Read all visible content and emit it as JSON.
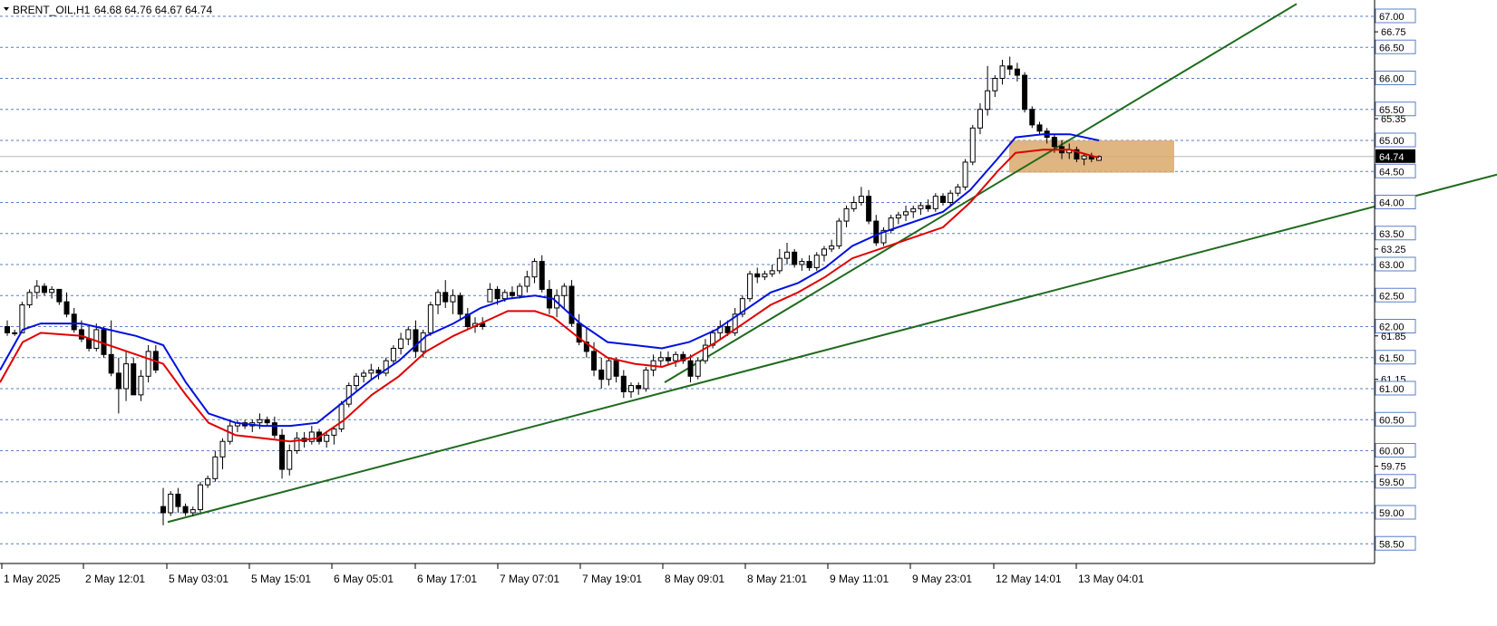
{
  "header": {
    "symbol": "BRENT_OIL,H1",
    "ohlc": "64.68 64.76 64.67 64.74"
  },
  "colors": {
    "background": "#ffffff",
    "grid": "#5b7fc7",
    "bull_candle": "#ffffff",
    "bear_candle": "#000000",
    "candle_outline": "#000000",
    "ma_fast": "#e00000",
    "ma_slow": "#0010e0",
    "trendline": "#1e6a1e",
    "zone_fill": "#d9a86b",
    "price_tag_bg": "#000000",
    "level_tag_bg": "#ffffff"
  },
  "chart_data": {
    "type": "candlestick",
    "timeframe": "H1",
    "y_range": [
      58.3,
      67.0
    ],
    "price_levels": [
      67.0,
      66.5,
      66.0,
      65.5,
      65.0,
      64.5,
      64.0,
      63.5,
      63.0,
      62.5,
      62.0,
      61.5,
      61.0,
      60.5,
      60.0,
      59.5,
      59.0,
      58.5
    ],
    "axis_ticks": [
      "67.00",
      "66.75",
      "66.50",
      "66.00",
      "65.50",
      "65.35",
      "65.00",
      "64.74",
      "64.50",
      "64.00",
      "63.50",
      "63.25",
      "63.00",
      "62.50",
      "62.00",
      "61.85",
      "61.50",
      "61.15",
      "61.00",
      "60.50",
      "60.00",
      "59.75",
      "59.50",
      "59.00",
      "58.50"
    ],
    "current_price": "64.74",
    "x_labels": [
      "1 May 2025",
      "2 May 12:01",
      "5 May 03:01",
      "5 May 15:01",
      "6 May 05:01",
      "6 May 17:01",
      "7 May 07:01",
      "7 May 19:01",
      "8 May 09:01",
      "8 May 21:01",
      "9 May 11:01",
      "9 May 23:01",
      "12 May 14:01",
      "13 May 04:01"
    ],
    "candles": [
      [
        62.0,
        62.1,
        61.85,
        61.9
      ],
      [
        61.9,
        61.95,
        61.85,
        61.9
      ],
      [
        61.9,
        62.4,
        61.9,
        62.35
      ],
      [
        62.35,
        62.6,
        62.3,
        62.55
      ],
      [
        62.55,
        62.75,
        62.45,
        62.65
      ],
      [
        62.65,
        62.7,
        62.5,
        62.55
      ],
      [
        62.55,
        62.65,
        62.45,
        62.6
      ],
      [
        62.6,
        62.6,
        62.35,
        62.4
      ],
      [
        62.4,
        62.55,
        62.15,
        62.2
      ],
      [
        62.2,
        62.3,
        61.9,
        61.95
      ],
      [
        61.95,
        62.1,
        61.75,
        61.8
      ],
      [
        61.8,
        62.0,
        61.6,
        61.65
      ],
      [
        61.65,
        62.05,
        61.6,
        61.95
      ],
      [
        61.95,
        62.0,
        61.5,
        61.55
      ],
      [
        61.55,
        62.1,
        61.2,
        61.25
      ],
      [
        61.25,
        61.5,
        60.6,
        61.0
      ],
      [
        61.0,
        61.6,
        60.8,
        61.4
      ],
      [
        61.4,
        61.5,
        60.9,
        60.9
      ],
      [
        60.9,
        61.3,
        60.8,
        61.2
      ],
      [
        61.2,
        61.7,
        61.1,
        61.6
      ],
      [
        61.6,
        61.7,
        61.25,
        61.3
      ],
      [
        59.1,
        59.4,
        58.8,
        59.0
      ],
      [
        59.0,
        59.35,
        58.95,
        59.3
      ],
      [
        59.3,
        59.4,
        59.0,
        59.1
      ],
      [
        59.1,
        59.15,
        58.95,
        59.0
      ],
      [
        59.0,
        59.1,
        58.95,
        59.05
      ],
      [
        59.05,
        59.5,
        59.0,
        59.45
      ],
      [
        59.45,
        59.6,
        59.4,
        59.55
      ],
      [
        59.55,
        60.0,
        59.5,
        59.9
      ],
      [
        59.9,
        60.2,
        59.7,
        60.15
      ],
      [
        60.15,
        60.5,
        60.1,
        60.4
      ],
      [
        60.4,
        60.5,
        60.3,
        60.45
      ],
      [
        60.45,
        60.5,
        60.35,
        60.4
      ],
      [
        60.4,
        60.5,
        60.3,
        60.45
      ],
      [
        60.45,
        60.6,
        60.35,
        60.5
      ],
      [
        60.5,
        60.55,
        60.4,
        60.45
      ],
      [
        60.45,
        60.55,
        60.2,
        60.25
      ],
      [
        60.25,
        60.35,
        59.55,
        59.7
      ],
      [
        59.7,
        60.1,
        59.6,
        60.0
      ],
      [
        60.0,
        60.3,
        59.95,
        60.2
      ],
      [
        60.2,
        60.3,
        60.05,
        60.15
      ],
      [
        60.15,
        60.4,
        60.1,
        60.3
      ],
      [
        60.3,
        60.35,
        60.1,
        60.15
      ],
      [
        60.15,
        60.3,
        60.05,
        60.25
      ],
      [
        60.25,
        60.4,
        60.1,
        60.35
      ],
      [
        60.35,
        60.8,
        60.3,
        60.75
      ],
      [
        60.75,
        61.1,
        60.7,
        61.05
      ],
      [
        61.05,
        61.25,
        60.95,
        61.2
      ],
      [
        61.2,
        61.3,
        61.1,
        61.25
      ],
      [
        61.25,
        61.4,
        61.15,
        61.3
      ],
      [
        61.3,
        61.35,
        61.15,
        61.25
      ],
      [
        61.25,
        61.5,
        61.2,
        61.45
      ],
      [
        61.45,
        61.7,
        61.4,
        61.65
      ],
      [
        61.65,
        61.9,
        61.55,
        61.8
      ],
      [
        61.8,
        62.0,
        61.7,
        61.95
      ],
      [
        61.95,
        62.1,
        61.5,
        61.6
      ],
      [
        61.6,
        61.95,
        61.5,
        61.9
      ],
      [
        61.9,
        62.4,
        61.85,
        62.35
      ],
      [
        62.35,
        62.6,
        62.2,
        62.55
      ],
      [
        62.55,
        62.75,
        62.3,
        62.4
      ],
      [
        62.4,
        62.6,
        62.2,
        62.5
      ],
      [
        62.5,
        62.55,
        62.1,
        62.2
      ],
      [
        62.2,
        62.3,
        61.95,
        62.0
      ],
      [
        62.0,
        62.15,
        61.9,
        62.05
      ],
      [
        62.05,
        62.15,
        61.95,
        62.0
      ],
      [
        62.4,
        62.7,
        62.4,
        62.6
      ],
      [
        62.6,
        62.65,
        62.35,
        62.45
      ],
      [
        62.45,
        62.6,
        62.4,
        62.55
      ],
      [
        62.55,
        62.65,
        62.45,
        62.5
      ],
      [
        62.5,
        62.7,
        62.45,
        62.65
      ],
      [
        62.65,
        62.9,
        62.55,
        62.8
      ],
      [
        62.8,
        63.1,
        62.7,
        63.05
      ],
      [
        63.05,
        63.15,
        62.55,
        62.6
      ],
      [
        62.6,
        62.75,
        62.2,
        62.3
      ],
      [
        62.3,
        62.6,
        62.15,
        62.5
      ],
      [
        62.5,
        62.7,
        62.3,
        62.65
      ],
      [
        62.65,
        62.75,
        62.0,
        62.05
      ],
      [
        62.05,
        62.2,
        61.7,
        61.75
      ],
      [
        61.75,
        62.0,
        61.5,
        61.6
      ],
      [
        61.6,
        61.75,
        61.2,
        61.3
      ],
      [
        61.3,
        61.5,
        61.0,
        61.15
      ],
      [
        61.15,
        61.5,
        61.05,
        61.45
      ],
      [
        61.45,
        61.5,
        61.1,
        61.2
      ],
      [
        61.2,
        61.3,
        60.85,
        60.95
      ],
      [
        60.95,
        61.1,
        60.85,
        61.05
      ],
      [
        61.05,
        61.1,
        60.9,
        61.0
      ],
      [
        61.0,
        61.35,
        60.95,
        61.3
      ],
      [
        61.3,
        61.55,
        61.2,
        61.45
      ],
      [
        61.45,
        61.6,
        61.35,
        61.5
      ],
      [
        61.5,
        61.6,
        61.4,
        61.45
      ],
      [
        61.45,
        61.6,
        61.35,
        61.55
      ],
      [
        61.55,
        61.6,
        61.4,
        61.45
      ],
      [
        61.45,
        61.55,
        61.1,
        61.2
      ],
      [
        61.2,
        61.5,
        61.15,
        61.45
      ],
      [
        61.45,
        61.8,
        61.4,
        61.7
      ],
      [
        61.7,
        61.95,
        61.65,
        61.9
      ],
      [
        61.9,
        62.1,
        61.8,
        62.0
      ],
      [
        62.0,
        62.1,
        61.85,
        61.9
      ],
      [
        61.9,
        62.3,
        61.85,
        62.2
      ],
      [
        62.2,
        62.5,
        62.15,
        62.45
      ],
      [
        62.45,
        62.9,
        62.4,
        62.85
      ],
      [
        62.85,
        62.95,
        62.7,
        62.8
      ],
      [
        62.8,
        62.9,
        62.75,
        62.85
      ],
      [
        62.85,
        63.0,
        62.8,
        62.9
      ],
      [
        62.9,
        63.25,
        62.85,
        63.1
      ],
      [
        63.1,
        63.35,
        63.0,
        63.2
      ],
      [
        63.2,
        63.25,
        62.95,
        63.0
      ],
      [
        63.0,
        63.1,
        62.9,
        63.05
      ],
      [
        63.05,
        63.15,
        62.9,
        62.95
      ],
      [
        62.95,
        63.2,
        62.9,
        63.15
      ],
      [
        63.15,
        63.3,
        63.05,
        63.25
      ],
      [
        63.25,
        63.4,
        63.2,
        63.3
      ],
      [
        63.3,
        63.75,
        63.25,
        63.7
      ],
      [
        63.7,
        63.95,
        63.6,
        63.9
      ],
      [
        63.9,
        64.1,
        63.85,
        64.0
      ],
      [
        64.0,
        64.25,
        63.95,
        64.1
      ],
      [
        64.1,
        64.2,
        63.65,
        63.7
      ],
      [
        63.7,
        63.8,
        63.3,
        63.35
      ],
      [
        63.35,
        63.6,
        63.3,
        63.55
      ],
      [
        63.55,
        63.8,
        63.5,
        63.75
      ],
      [
        63.75,
        63.85,
        63.65,
        63.8
      ],
      [
        63.8,
        63.95,
        63.7,
        63.85
      ],
      [
        63.85,
        63.95,
        63.75,
        63.9
      ],
      [
        63.9,
        64.0,
        63.8,
        63.95
      ],
      [
        63.95,
        64.05,
        63.85,
        63.9
      ],
      [
        63.9,
        64.15,
        63.85,
        64.1
      ],
      [
        64.1,
        64.15,
        63.95,
        64.0
      ],
      [
        64.0,
        64.2,
        63.95,
        64.15
      ],
      [
        64.15,
        64.3,
        64.1,
        64.25
      ],
      [
        64.25,
        64.7,
        64.2,
        64.65
      ],
      [
        64.65,
        65.25,
        64.6,
        65.2
      ],
      [
        65.2,
        65.6,
        65.1,
        65.5
      ],
      [
        65.5,
        66.2,
        65.4,
        65.8
      ],
      [
        65.8,
        66.05,
        65.7,
        66.0
      ],
      [
        66.0,
        66.3,
        65.9,
        66.2
      ],
      [
        66.2,
        66.35,
        66.05,
        66.15
      ],
      [
        66.15,
        66.25,
        65.95,
        66.05
      ],
      [
        66.05,
        66.1,
        65.45,
        65.5
      ],
      [
        65.5,
        65.55,
        65.2,
        65.25
      ],
      [
        65.25,
        65.3,
        65.1,
        65.15
      ],
      [
        65.15,
        65.2,
        64.95,
        65.05
      ],
      [
        65.05,
        65.1,
        64.8,
        64.9
      ],
      [
        64.9,
        65.0,
        64.7,
        64.8
      ],
      [
        64.8,
        64.95,
        64.7,
        64.85
      ],
      [
        64.85,
        64.9,
        64.65,
        64.7
      ],
      [
        64.7,
        64.8,
        64.6,
        64.75
      ],
      [
        64.75,
        64.8,
        64.65,
        64.7
      ],
      [
        64.68,
        64.76,
        64.67,
        64.74
      ]
    ],
    "ma_fast_name": "",
    "ma_slow_name": "",
    "ma_fast": [
      [
        0,
        61.1
      ],
      [
        25,
        61.75
      ],
      [
        45,
        61.9
      ],
      [
        90,
        61.85
      ],
      [
        150,
        61.55
      ],
      [
        180,
        61.4
      ],
      [
        205,
        60.9
      ],
      [
        230,
        60.45
      ],
      [
        260,
        60.25
      ],
      [
        290,
        60.2
      ],
      [
        320,
        60.15
      ],
      [
        350,
        60.2
      ],
      [
        380,
        60.5
      ],
      [
        410,
        60.9
      ],
      [
        440,
        61.2
      ],
      [
        470,
        61.6
      ],
      [
        500,
        61.85
      ],
      [
        530,
        62.05
      ],
      [
        560,
        62.25
      ],
      [
        590,
        62.25
      ],
      [
        610,
        62.15
      ],
      [
        640,
        61.8
      ],
      [
        670,
        61.5
      ],
      [
        700,
        61.4
      ],
      [
        730,
        61.35
      ],
      [
        760,
        61.5
      ],
      [
        790,
        61.75
      ],
      [
        820,
        62.05
      ],
      [
        850,
        62.35
      ],
      [
        880,
        62.55
      ],
      [
        910,
        62.8
      ],
      [
        940,
        63.1
      ],
      [
        970,
        63.25
      ],
      [
        1000,
        63.4
      ],
      [
        1040,
        63.6
      ],
      [
        1070,
        64.0
      ],
      [
        1100,
        64.5
      ],
      [
        1120,
        64.8
      ],
      [
        1150,
        64.85
      ],
      [
        1180,
        64.85
      ],
      [
        1212,
        64.72
      ]
    ],
    "ma_slow": [
      [
        0,
        61.3
      ],
      [
        25,
        61.95
      ],
      [
        45,
        62.05
      ],
      [
        90,
        62.05
      ],
      [
        150,
        61.85
      ],
      [
        180,
        61.7
      ],
      [
        205,
        61.1
      ],
      [
        230,
        60.6
      ],
      [
        260,
        60.45
      ],
      [
        290,
        60.4
      ],
      [
        320,
        60.4
      ],
      [
        350,
        60.45
      ],
      [
        380,
        60.8
      ],
      [
        410,
        61.15
      ],
      [
        440,
        61.45
      ],
      [
        470,
        61.85
      ],
      [
        500,
        62.05
      ],
      [
        530,
        62.3
      ],
      [
        560,
        62.45
      ],
      [
        590,
        62.5
      ],
      [
        610,
        62.45
      ],
      [
        640,
        62.05
      ],
      [
        670,
        61.75
      ],
      [
        700,
        61.7
      ],
      [
        730,
        61.65
      ],
      [
        760,
        61.75
      ],
      [
        790,
        61.95
      ],
      [
        820,
        62.25
      ],
      [
        850,
        62.55
      ],
      [
        880,
        62.7
      ],
      [
        910,
        62.95
      ],
      [
        940,
        63.3
      ],
      [
        970,
        63.5
      ],
      [
        1000,
        63.65
      ],
      [
        1040,
        63.85
      ],
      [
        1070,
        64.2
      ],
      [
        1100,
        64.7
      ],
      [
        1120,
        65.05
      ],
      [
        1150,
        65.1
      ],
      [
        1180,
        65.1
      ],
      [
        1212,
        65.0
      ]
    ],
    "trendlines": [
      [
        [
          185,
          58.85
        ],
        [
          1651,
          64.45
        ]
      ],
      [
        [
          733,
          61.1
        ],
        [
          1430,
          67.2
        ]
      ]
    ],
    "zone": {
      "x0": 1113,
      "x1": 1295,
      "y_top": 65.0,
      "y_bottom": 64.48
    }
  }
}
